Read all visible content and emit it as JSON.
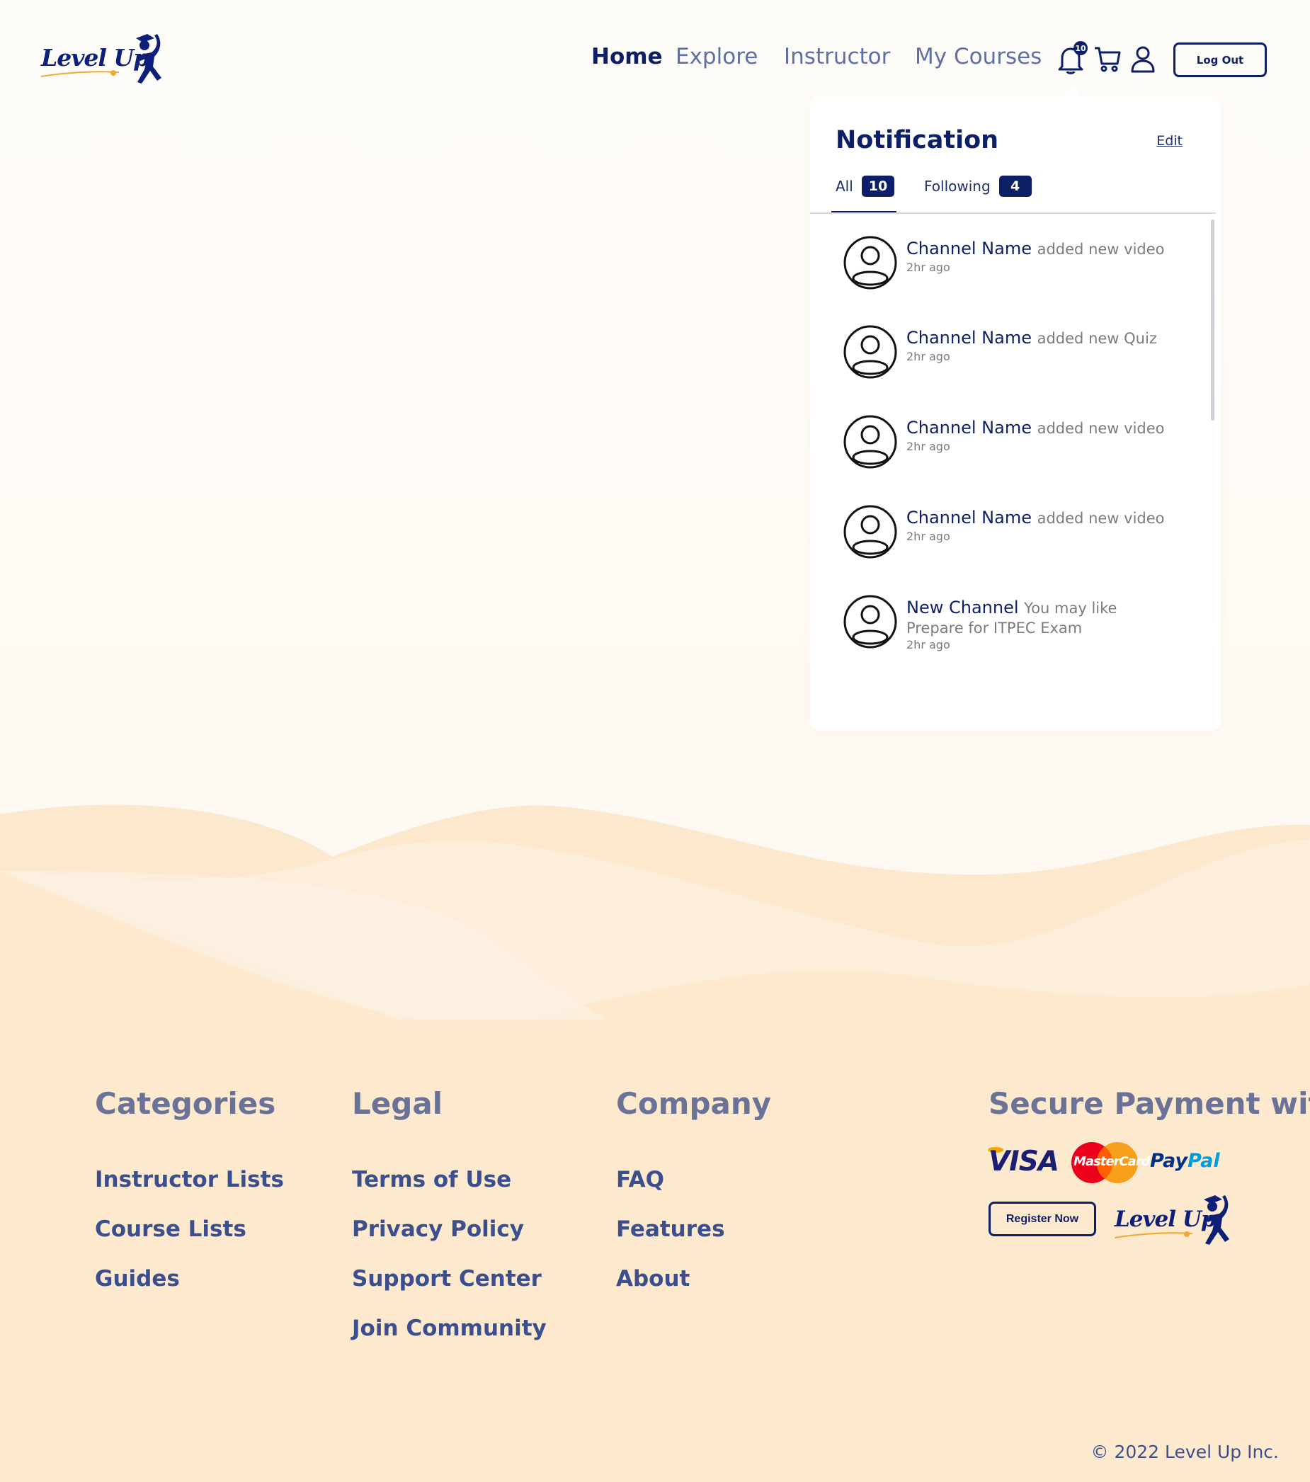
{
  "brand": {
    "name": "Level Up"
  },
  "nav": {
    "items": [
      "Home",
      "Explore",
      "Instructor",
      "My Courses"
    ],
    "active": "Home",
    "notification_count": "10",
    "logout_label": "Log Out"
  },
  "notifications": {
    "title": "Notification",
    "edit_label": "Edit",
    "tabs": [
      {
        "label": "All",
        "count": "10"
      },
      {
        "label": "Following",
        "count": "4"
      }
    ],
    "active_tab": "All",
    "items": [
      {
        "name": "Channel Name",
        "action": "added new video",
        "subtitle": "",
        "time": "2hr ago"
      },
      {
        "name": "Channel Name",
        "action": "added new Quiz",
        "subtitle": "",
        "time": "2hr ago"
      },
      {
        "name": "Channel Name",
        "action": "added new video",
        "subtitle": "",
        "time": "2hr ago"
      },
      {
        "name": "Channel Name",
        "action": "added new video",
        "subtitle": "",
        "time": "2hr ago"
      },
      {
        "name": "New Channel",
        "action": "You may like",
        "subtitle": "Prepare for ITPEC Exam",
        "time": "2hr ago"
      }
    ]
  },
  "footer": {
    "categories": {
      "heading": "Categories",
      "links": [
        "Instructor Lists",
        "Course Lists",
        "Guides"
      ]
    },
    "legal": {
      "heading": "Legal",
      "links": [
        "Terms of Use",
        "Privacy Policy",
        "Support Center",
        "Join Community"
      ]
    },
    "company": {
      "heading": "Company",
      "links": [
        "FAQ",
        "Features",
        "About"
      ]
    },
    "payment": {
      "heading": "Secure Payment with",
      "methods": [
        "VISA",
        "MasterCard",
        "PayPal"
      ],
      "register_label": "Register Now"
    },
    "copyright": "© 2022 Level Up Inc."
  },
  "colors": {
    "primary": "#0d1f66",
    "link": "#3b4f8f",
    "muted": "#6a7397",
    "background": "#fdf9f4",
    "footer_background": "#fde9cd",
    "accent": "#f2a830"
  }
}
